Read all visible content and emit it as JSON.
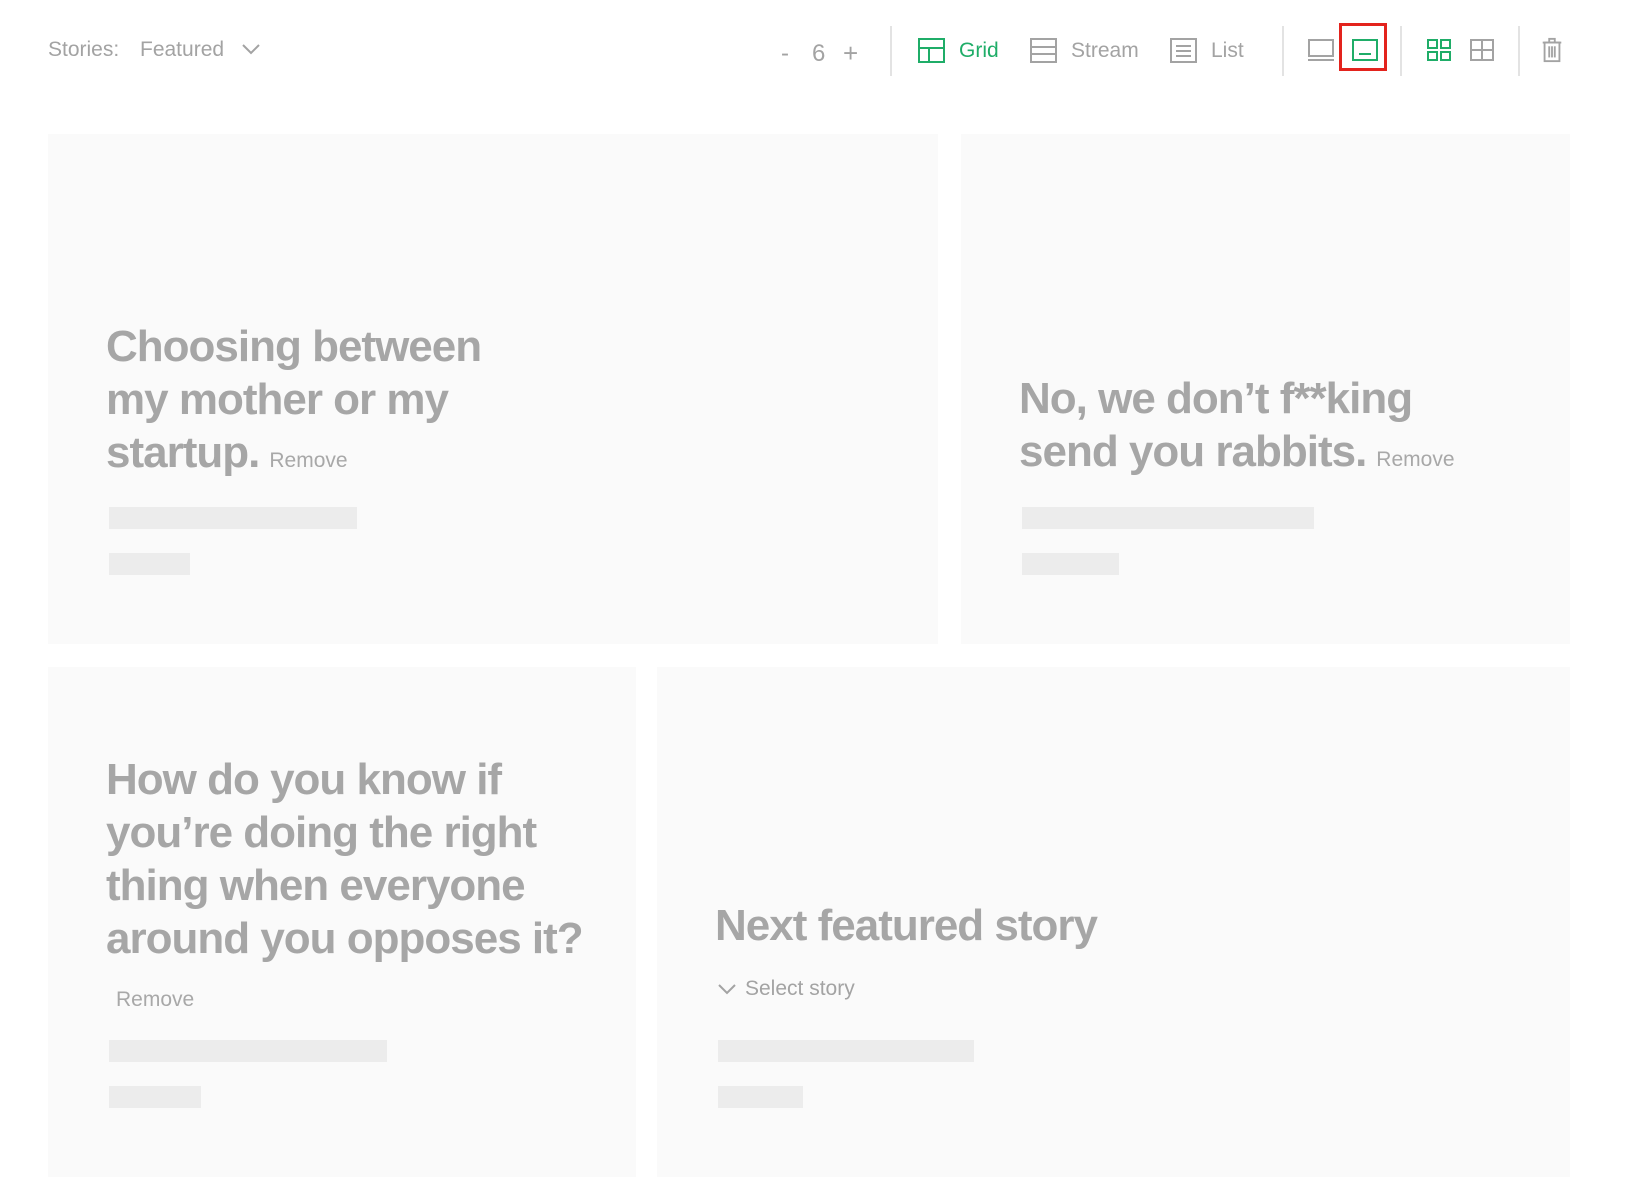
{
  "toolbar": {
    "stories_label": "Stories:",
    "stories_value": "Featured",
    "count": {
      "minus": "-",
      "value": "6",
      "plus": "+"
    },
    "modes": [
      {
        "label": "Grid",
        "icon": "grid-layout-icon",
        "active": true
      },
      {
        "label": "Stream",
        "icon": "stream-layout-icon",
        "active": false
      },
      {
        "label": "List",
        "icon": "list-layout-icon",
        "active": false
      }
    ],
    "accent_color": "#1fad68",
    "highlight_color": "#e3231d"
  },
  "cards": [
    {
      "title": "Choosing between my mother or my startup.",
      "remove": "Remove"
    },
    {
      "title": "No, we don’t f**king send you rabbits.",
      "remove": "Remove"
    },
    {
      "title": "How do you know if you’re doing the right thing when everyone around you opposes it?",
      "remove": "Remove"
    },
    {
      "title": "Next featured story",
      "select_label": "Select story"
    }
  ]
}
